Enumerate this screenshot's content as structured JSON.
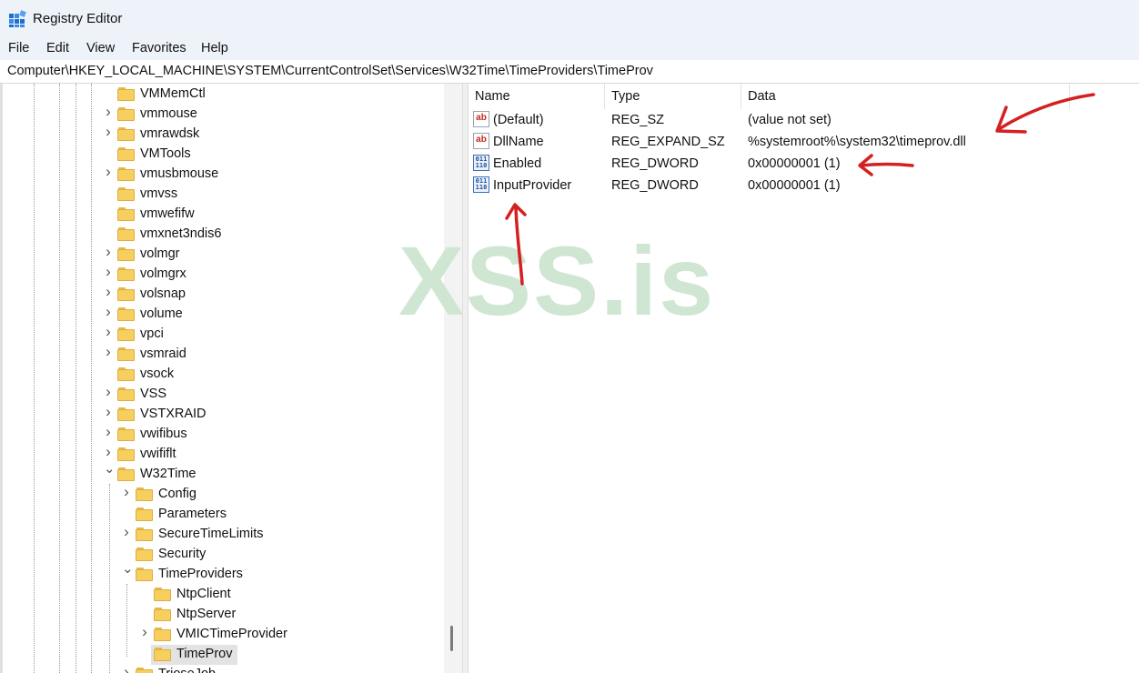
{
  "window": {
    "title": "Registry Editor"
  },
  "menu": [
    "File",
    "Edit",
    "View",
    "Favorites",
    "Help"
  ],
  "address": "Computer\\HKEY_LOCAL_MACHINE\\SYSTEM\\CurrentControlSet\\Services\\W32Time\\TimeProviders\\TimeProv",
  "tree": [
    {
      "label": "VMMemCtl",
      "depth": 0,
      "expander": "none"
    },
    {
      "label": "vmmouse",
      "depth": 0,
      "expander": "collapsed"
    },
    {
      "label": "vmrawdsk",
      "depth": 0,
      "expander": "collapsed"
    },
    {
      "label": "VMTools",
      "depth": 0,
      "expander": "none"
    },
    {
      "label": "vmusbmouse",
      "depth": 0,
      "expander": "collapsed"
    },
    {
      "label": "vmvss",
      "depth": 0,
      "expander": "none"
    },
    {
      "label": "vmwefifw",
      "depth": 0,
      "expander": "none"
    },
    {
      "label": "vmxnet3ndis6",
      "depth": 0,
      "expander": "none"
    },
    {
      "label": "volmgr",
      "depth": 0,
      "expander": "collapsed"
    },
    {
      "label": "volmgrx",
      "depth": 0,
      "expander": "collapsed"
    },
    {
      "label": "volsnap",
      "depth": 0,
      "expander": "collapsed"
    },
    {
      "label": "volume",
      "depth": 0,
      "expander": "collapsed"
    },
    {
      "label": "vpci",
      "depth": 0,
      "expander": "collapsed"
    },
    {
      "label": "vsmraid",
      "depth": 0,
      "expander": "collapsed"
    },
    {
      "label": "vsock",
      "depth": 0,
      "expander": "none"
    },
    {
      "label": "VSS",
      "depth": 0,
      "expander": "collapsed"
    },
    {
      "label": "VSTXRAID",
      "depth": 0,
      "expander": "collapsed"
    },
    {
      "label": "vwifibus",
      "depth": 0,
      "expander": "collapsed"
    },
    {
      "label": "vwififlt",
      "depth": 0,
      "expander": "collapsed"
    },
    {
      "label": "W32Time",
      "depth": 0,
      "expander": "expanded"
    },
    {
      "label": "Config",
      "depth": 1,
      "expander": "collapsed"
    },
    {
      "label": "Parameters",
      "depth": 1,
      "expander": "none"
    },
    {
      "label": "SecureTimeLimits",
      "depth": 1,
      "expander": "collapsed"
    },
    {
      "label": "Security",
      "depth": 1,
      "expander": "none"
    },
    {
      "label": "TimeProviders",
      "depth": 1,
      "expander": "expanded"
    },
    {
      "label": "NtpClient",
      "depth": 2,
      "expander": "none"
    },
    {
      "label": "NtpServer",
      "depth": 2,
      "expander": "none"
    },
    {
      "label": "VMICTimeProvider",
      "depth": 2,
      "expander": "collapsed"
    },
    {
      "label": "TimeProv",
      "depth": 2,
      "expander": "none",
      "selected": true
    },
    {
      "label": "TrioseJob",
      "depth": 1,
      "expander": "collapsed"
    }
  ],
  "list": {
    "columns": [
      "Name",
      "Type",
      "Data"
    ],
    "rows": [
      {
        "name": "(Default)",
        "type": "REG_SZ",
        "data": "(value not set)",
        "icon": "string-value-icon"
      },
      {
        "name": "DllName",
        "type": "REG_EXPAND_SZ",
        "data": "%systemroot%\\system32\\timeprov.dll",
        "icon": "string-value-icon"
      },
      {
        "name": "Enabled",
        "type": "REG_DWORD",
        "data": "0x00000001 (1)",
        "icon": "binary-value-icon"
      },
      {
        "name": "InputProvider",
        "type": "REG_DWORD",
        "data": "0x00000001 (1)",
        "icon": "binary-value-icon"
      }
    ]
  },
  "icon_glyphs": {
    "string": "ab",
    "binary": "011\n110"
  },
  "watermark": "XSS.is",
  "colors": {
    "annotation": "#d42020",
    "watermark": "#cfe6d2",
    "titlebar": "#eef3fa"
  }
}
